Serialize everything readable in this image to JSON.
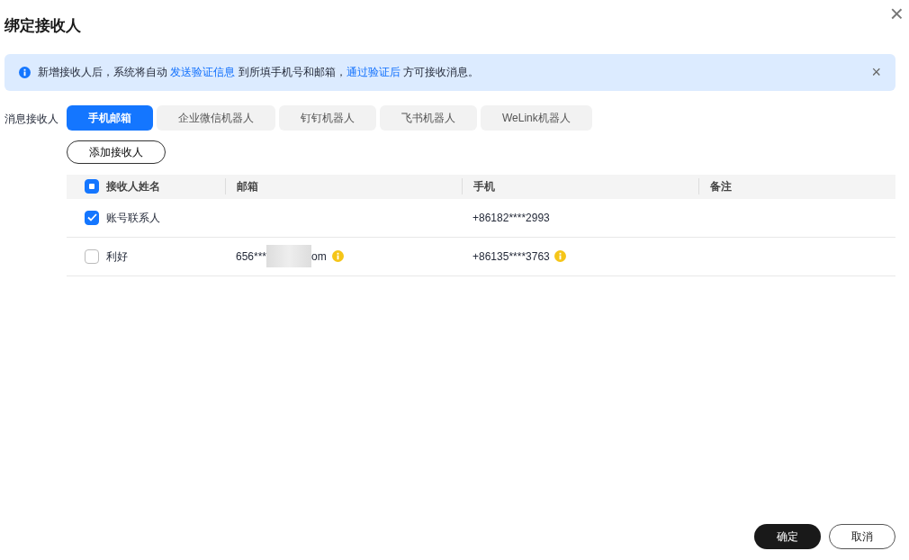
{
  "dialog": {
    "title": "绑定接收人",
    "close": "×"
  },
  "alert": {
    "parts": [
      {
        "kind": "text",
        "text": "新增接收人后，系统将自动 "
      },
      {
        "kind": "link",
        "text": "发送验证信息"
      },
      {
        "kind": "text",
        "text": " 到所填手机号和邮箱，"
      },
      {
        "kind": "link",
        "text": "通过验证后"
      },
      {
        "kind": "text",
        "text": " 方可接收消息。"
      }
    ],
    "dismiss": "×"
  },
  "recipient_label": "消息接收人",
  "tabs": [
    {
      "label": "手机邮箱",
      "selected": true
    },
    {
      "label": "企业微信机器人",
      "selected": false
    },
    {
      "label": "钉钉机器人",
      "selected": false
    },
    {
      "label": "飞书机器人",
      "selected": false
    },
    {
      "label": "WeLink机器人",
      "selected": false
    }
  ],
  "add_button": "添加接收人",
  "table": {
    "select_all_indeterminate": true,
    "columns": [
      "接收人姓名",
      "邮箱",
      "手机",
      "备注"
    ],
    "rows": [
      {
        "selected": true,
        "name": "账号联系人",
        "phone": {
          "text": "+86182****2993",
          "warning": false
        }
      },
      {
        "selected": false,
        "name": "利好",
        "email": {
          "start": "656***",
          "end": "om",
          "redacted": true,
          "warning": true
        },
        "phone": {
          "text": "+86135****3763",
          "warning": true
        }
      }
    ]
  },
  "footer": {
    "confirm": "确定",
    "cancel": "取消"
  }
}
